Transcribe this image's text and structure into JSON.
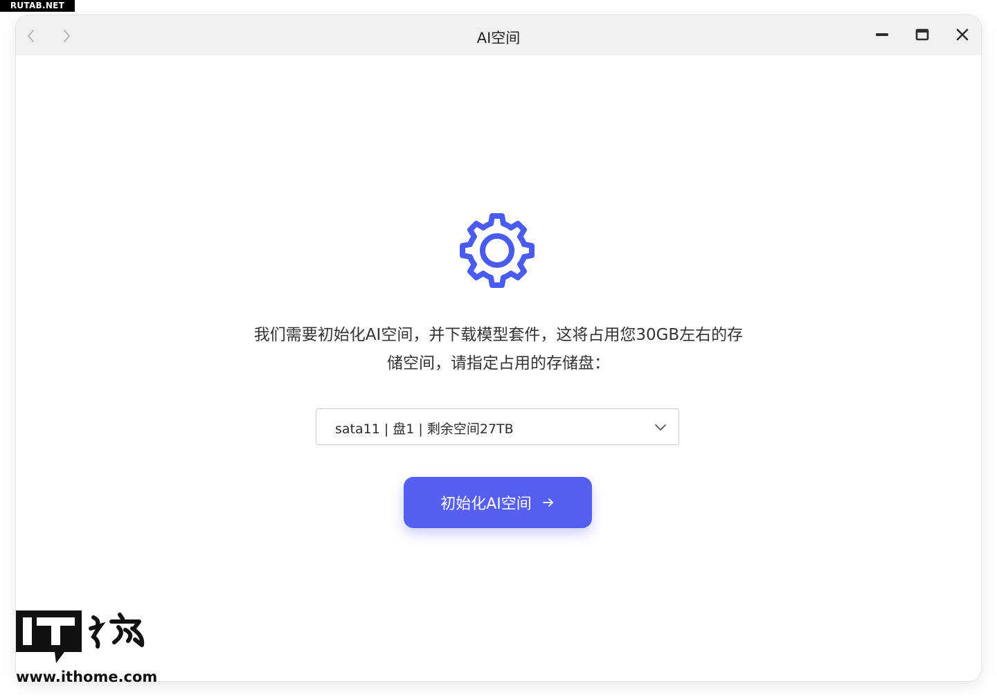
{
  "watermarks": {
    "top_left": "RUTAB.NET",
    "bottom_left_url": "www.ithome.com",
    "bottom_left_logo": "IT之家"
  },
  "window": {
    "title": "AI空间",
    "nav": {
      "back_icon": "chevron-left-icon",
      "forward_icon": "chevron-right-icon"
    },
    "controls": {
      "minimize_icon": "minimize-icon",
      "maximize_icon": "maximize-icon",
      "close_icon": "close-icon"
    }
  },
  "main": {
    "icon": "gear-icon",
    "message_line1": "我们需要初始化AI空间，并下载模型套件，这将占用您30GB左右的存",
    "message_line2": "储空间，请指定占用的存储盘：",
    "disk_select": {
      "value": "sata11 | 盘1 | 剩余空间27TB",
      "chevron_icon": "chevron-down-icon"
    },
    "init_button": {
      "label": "初始化AI空间",
      "arrow_icon": "arrow-right-icon"
    }
  },
  "colors": {
    "accent": "#5560f3",
    "gear": "#4a5cf0",
    "titlebar": "#f0f0f2",
    "text": "#333333"
  }
}
